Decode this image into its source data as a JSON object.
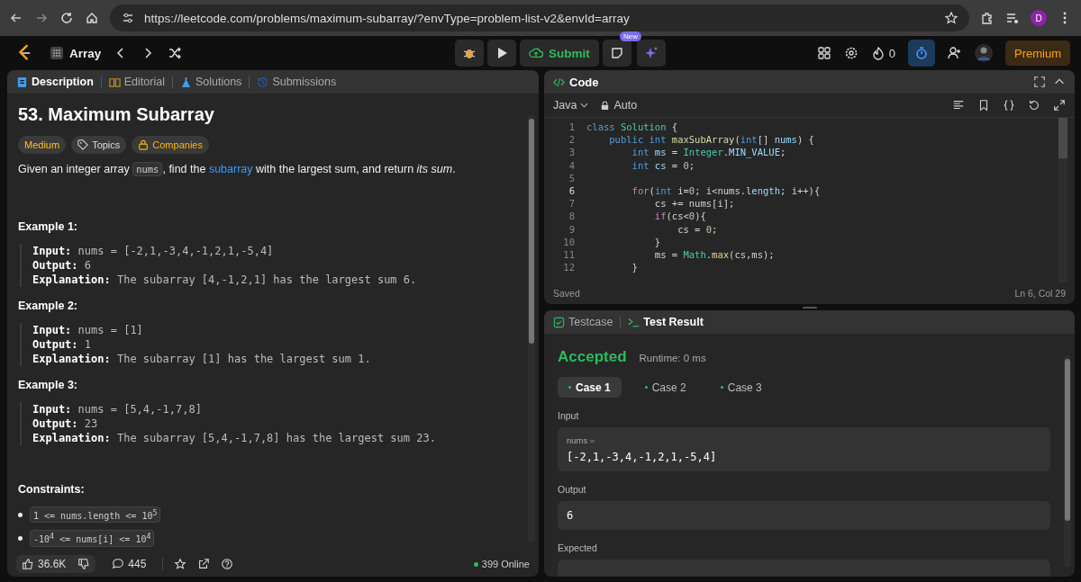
{
  "browser": {
    "url": "https://leetcode.com/problems/maximum-subarray/?envType=problem-list-v2&envId=array",
    "profile": "D"
  },
  "nav": {
    "list": "Array",
    "submit": "Submit",
    "new_badge": "New",
    "streak": "0",
    "premium": "Premium"
  },
  "description": {
    "tabs": [
      {
        "label": "Description",
        "selected": true
      },
      {
        "label": "Editorial",
        "selected": false
      },
      {
        "label": "Solutions",
        "selected": false
      },
      {
        "label": "Submissions",
        "selected": false
      }
    ],
    "title": "53. Maximum Subarray",
    "tags": [
      {
        "kind": "difficulty",
        "label": "Medium"
      },
      {
        "kind": "topics",
        "label": "Topics"
      },
      {
        "kind": "companies",
        "label": "Companies"
      }
    ],
    "statement": [
      {
        "kind": "text",
        "text": "Given an integer array "
      },
      {
        "kind": "code",
        "text": "nums"
      },
      {
        "kind": "text",
        "text": ", find the "
      },
      {
        "kind": "link",
        "text": "subarray"
      },
      {
        "kind": "text",
        "text": " with the largest sum, and return *its sum*."
      }
    ],
    "examples": [
      {
        "heading": "Example 1:",
        "input_label": "Input:",
        "input": "nums = [-2,1,-3,4,-1,2,1,-5,4]",
        "output_label": "Output:",
        "output": "6",
        "explanation_label": "Explanation:",
        "explanation": "The subarray [4,-1,2,1] has the largest sum 6."
      },
      {
        "heading": "Example 2:",
        "input_label": "Input:",
        "input": "nums = [1]",
        "output_label": "Output:",
        "output": "1",
        "explanation_label": "Explanation:",
        "explanation": "The subarray [1] has the largest sum 1."
      },
      {
        "heading": "Example 3:",
        "input_label": "Input:",
        "input": "nums = [5,4,-1,7,8]",
        "output_label": "Output:",
        "output": "23",
        "explanation_label": "Explanation:",
        "explanation": "The subarray [5,4,-1,7,8] has the largest sum 23."
      }
    ],
    "constraints_heading": "Constraints:",
    "constraints": [
      "1 <= nums.length <= 10$^{5}$",
      "-10$^{4}$ <= nums[i] <= 10$^{4}$"
    ],
    "likes": "36.6K",
    "comments": "445",
    "online": "399 Online"
  },
  "code": {
    "title": "Code",
    "language": "Java",
    "mode": "Auto",
    "lines": [
      {
        "number": "1",
        "current": false,
        "tokens": [
          {
            "kind": "kw",
            "text": "class"
          },
          {
            "kind": "type",
            "text": " Solution"
          },
          {
            "kind": "plain",
            "text": " {"
          }
        ]
      },
      {
        "number": "2",
        "current": false,
        "tokens": [
          {
            "kind": "kw",
            "text": "    public int"
          },
          {
            "kind": "fn",
            "text": " maxSubArray"
          },
          {
            "kind": "plain",
            "text": "("
          },
          {
            "kind": "kw",
            "text": "int"
          },
          {
            "kind": "plain",
            "text": "[]"
          },
          {
            "kind": "var",
            "text": " nums"
          },
          {
            "kind": "plain",
            "text": ") {"
          }
        ]
      },
      {
        "number": "3",
        "current": false,
        "tokens": [
          {
            "kind": "kw",
            "text": "        int"
          },
          {
            "kind": "var",
            "text": " ms"
          },
          {
            "kind": "plain",
            "text": " ="
          },
          {
            "kind": "type",
            "text": " Integer"
          },
          {
            "kind": "plain",
            "text": "."
          },
          {
            "kind": "var",
            "text": "MIN_VALUE"
          },
          {
            "kind": "plain",
            "text": ";"
          }
        ]
      },
      {
        "number": "4",
        "current": false,
        "tokens": [
          {
            "kind": "kw",
            "text": "        int"
          },
          {
            "kind": "var",
            "text": " cs"
          },
          {
            "kind": "plain",
            "text": " ="
          },
          {
            "kind": "num",
            "text": " 0"
          },
          {
            "kind": "plain",
            "text": ";"
          }
        ]
      },
      {
        "number": "5",
        "current": false
      },
      {
        "number": "6",
        "current": true,
        "tokens": [
          {
            "kind": "ctrl",
            "text": "        for"
          },
          {
            "kind": "plain",
            "text": "("
          },
          {
            "kind": "kw",
            "text": "int"
          },
          {
            "kind": "plain",
            "text": " i="
          },
          {
            "kind": "num",
            "text": "0"
          },
          {
            "kind": "plain",
            "text": "; i<nums."
          },
          {
            "kind": "var",
            "text": "length"
          },
          {
            "kind": "plain",
            "text": "; i++){"
          }
        ]
      },
      {
        "number": "7",
        "current": false,
        "tokens": [
          {
            "kind": "plain",
            "text": "            cs += nums[i];"
          }
        ]
      },
      {
        "number": "8",
        "current": false,
        "tokens": [
          {
            "kind": "ctrl",
            "text": "            if"
          },
          {
            "kind": "plain",
            "text": "(cs<"
          },
          {
            "kind": "num",
            "text": "0"
          },
          {
            "kind": "plain",
            "text": "){"
          }
        ]
      },
      {
        "number": "9",
        "current": false,
        "tokens": [
          {
            "kind": "plain",
            "text": "                cs ="
          },
          {
            "kind": "num",
            "text": " 0"
          },
          {
            "kind": "plain",
            "text": ";"
          }
        ]
      },
      {
        "number": "10",
        "current": false,
        "tokens": [
          {
            "kind": "plain",
            "text": "            }"
          }
        ]
      },
      {
        "number": "11",
        "current": false,
        "tokens": [
          {
            "kind": "plain",
            "text": "            ms ="
          },
          {
            "kind": "type",
            "text": " Math"
          },
          {
            "kind": "plain",
            "text": "."
          },
          {
            "kind": "fn",
            "text": "max"
          },
          {
            "kind": "plain",
            "text": "(cs,ms);"
          }
        ]
      },
      {
        "number": "12",
        "current": false,
        "tokens": [
          {
            "kind": "plain",
            "text": "        }"
          }
        ]
      }
    ],
    "status": "Saved",
    "cursor": "Ln 6, Col 29"
  },
  "result": {
    "tabs": [
      {
        "label": "Testcase",
        "selected": false
      },
      {
        "label": "Test Result",
        "selected": true
      }
    ],
    "verdict": "Accepted",
    "runtime": "Runtime: 0 ms",
    "cases": [
      {
        "label": "Case 1",
        "selected": true
      },
      {
        "label": "Case 2",
        "selected": false
      },
      {
        "label": "Case 3",
        "selected": false
      }
    ],
    "input_label": "Input",
    "input_name": "nums =",
    "input_value": "[-2,1,-3,4,-1,2,1,-5,4]",
    "output_label": "Output",
    "output_value": "6",
    "expected_label": "Expected"
  }
}
